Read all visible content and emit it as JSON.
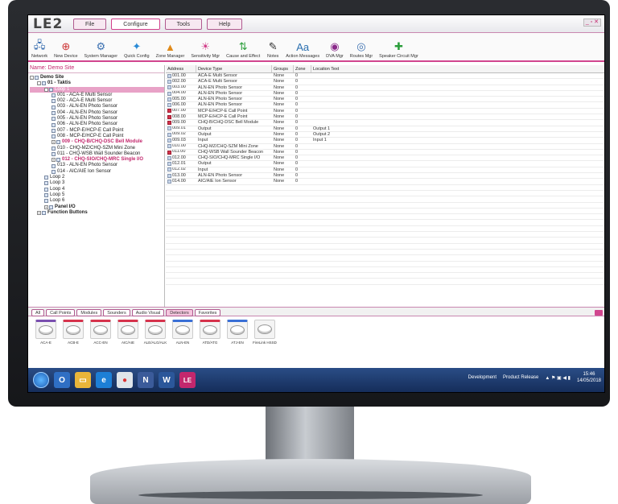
{
  "app": {
    "logo": "LE2"
  },
  "menu": [
    "File",
    "Configure",
    "Tools",
    "Help"
  ],
  "toolbar": [
    {
      "label": "Network",
      "icon": "network-icon"
    },
    {
      "label": "New Device",
      "icon": "new-device-icon"
    },
    {
      "label": "System Manager",
      "icon": "system-manager-icon"
    },
    {
      "label": "Quick Config",
      "icon": "quick-config-icon"
    },
    {
      "label": "Zone Manager",
      "icon": "zone-manager-icon"
    },
    {
      "label": "Sensitivity Mgr",
      "icon": "sensitivity-icon"
    },
    {
      "label": "Cause and Effect",
      "icon": "cause-effect-icon"
    },
    {
      "label": "Notes",
      "icon": "notes-icon"
    },
    {
      "label": "Action Messages",
      "icon": "action-messages-icon"
    },
    {
      "label": "DVA Mgr",
      "icon": "dva-icon"
    },
    {
      "label": "Routes Mgr",
      "icon": "routes-icon"
    },
    {
      "label": "Speaker Circuit Mgr",
      "icon": "speaker-circuit-icon"
    }
  ],
  "site_name": "Name: Demo Site",
  "tree": [
    {
      "label": "Demo Site",
      "indent": 0,
      "bold": true,
      "exp": "-"
    },
    {
      "label": "01 - Taktis",
      "indent": 1,
      "bold": true,
      "exp": "-"
    },
    {
      "label": "Loop 1",
      "indent": 2,
      "sel": true,
      "exp": "-"
    },
    {
      "label": "001 - ACA-E Multi Sensor",
      "indent": 3
    },
    {
      "label": "002 - ACA-E Multi Sensor",
      "indent": 3
    },
    {
      "label": "003 - ALN-EN Photo Sensor",
      "indent": 3
    },
    {
      "label": "004 - ALN-EN Photo Sensor",
      "indent": 3
    },
    {
      "label": "005 - ALN-EN Photo Sensor",
      "indent": 3
    },
    {
      "label": "006 - ALN-EN Photo Sensor",
      "indent": 3
    },
    {
      "label": "007 - MCP-E/HCP-E Call Point",
      "indent": 3
    },
    {
      "label": "008 - MCP-E/HCP-E Call Point",
      "indent": 3
    },
    {
      "label": "009 - CHQ-B/CHQ-DSC Bell Module",
      "indent": 3,
      "red": true,
      "exp": "+"
    },
    {
      "label": "010 - CHQ-MZ/CHQ-SZM Mini Zone",
      "indent": 3
    },
    {
      "label": "011 - CHQ-WSB Wall Sounder Beacon",
      "indent": 3
    },
    {
      "label": "012 - CHQ-SIO/CHQ-MRC Single I/O",
      "indent": 3,
      "red": true,
      "exp": "+"
    },
    {
      "label": "013 - ALN-EN Photo Sensor",
      "indent": 3
    },
    {
      "label": "014 - AIC/AIE Ion Sensor",
      "indent": 3
    },
    {
      "label": "Loop 2",
      "indent": 2
    },
    {
      "label": "Loop 3",
      "indent": 2
    },
    {
      "label": "Loop 4",
      "indent": 2
    },
    {
      "label": "Loop 5",
      "indent": 2
    },
    {
      "label": "Loop 6",
      "indent": 2
    },
    {
      "label": "Panel I/O",
      "indent": 2,
      "bold": true,
      "exp": "+"
    },
    {
      "label": "Function Buttons",
      "indent": 1,
      "bold": true,
      "exp": "+"
    }
  ],
  "grid": {
    "headers": [
      "Address",
      "Device Type",
      "Groups",
      "Zone",
      "Location Text"
    ],
    "rows": [
      [
        "001.00",
        "ACA-E Multi Sensor",
        "None",
        "0",
        ""
      ],
      [
        "002.00",
        "ACA-E Multi Sensor",
        "None",
        "0",
        ""
      ],
      [
        "003.00",
        "ALN-EN Photo Sensor",
        "None",
        "0",
        ""
      ],
      [
        "004.00",
        "ALN-EN Photo Sensor",
        "None",
        "0",
        ""
      ],
      [
        "005.00",
        "ALN-EN Photo Sensor",
        "None",
        "0",
        ""
      ],
      [
        "006.00",
        "ALN-EN Photo Sensor",
        "None",
        "0",
        ""
      ],
      [
        "007.00",
        "MCP-E/HCP-E Call Point",
        "None",
        "0",
        ""
      ],
      [
        "008.00",
        "MCP-E/HCP-E Call Point",
        "None",
        "0",
        ""
      ],
      [
        "009.00",
        "CHQ-B/CHQ-DSC Bell Module",
        "None",
        "0",
        ""
      ],
      [
        "009.01",
        "Output",
        "None",
        "0",
        "Output 1"
      ],
      [
        "009.02",
        "Output",
        "None",
        "0",
        "Output 2"
      ],
      [
        "009.03",
        "Input",
        "None",
        "0",
        "Input 1"
      ],
      [
        "010.00",
        "CHQ-MZ/CHQ-SZM Mini Zone",
        "None",
        "0",
        ""
      ],
      [
        "011.00",
        "CHQ-WSB Wall Sounder Beacon",
        "None",
        "0",
        ""
      ],
      [
        "012.00",
        "CHQ-SIO/CHQ-MRC Single I/O",
        "None",
        "0",
        ""
      ],
      [
        "012.01",
        "Output",
        "None",
        "0",
        ""
      ],
      [
        "012.02",
        "Input",
        "None",
        "0",
        ""
      ],
      [
        "013.00",
        "ALN-EN Photo Sensor",
        "None",
        "0",
        ""
      ],
      [
        "014.00",
        "AIC/AIE Ion Sensor",
        "None",
        "0",
        ""
      ]
    ]
  },
  "palette": {
    "tabs": [
      "All",
      "Call Points",
      "Modules",
      "Sounders",
      "Audio Visual",
      "Detectors",
      "Favorites"
    ],
    "devices": [
      "ACA-E",
      "ACB-E",
      "ACC-EN",
      "AIC/AIE",
      "ALE/ALG/ALK",
      "ALN-EN",
      "ATD/ATG",
      "ATJ-EN",
      "FireLink HSSD"
    ]
  },
  "taskbar": {
    "tray_items": [
      "Development",
      "Product Release"
    ],
    "time": "15:46",
    "date": "14/05/2018"
  }
}
